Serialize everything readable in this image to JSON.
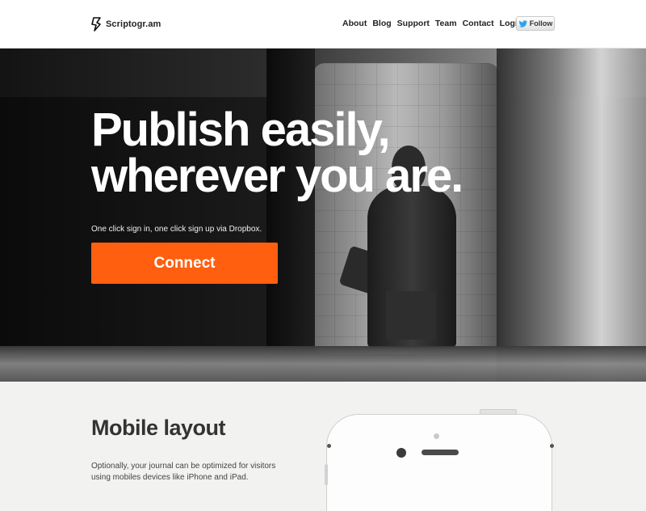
{
  "header": {
    "logo_text": "Scriptogr.am",
    "nav": [
      "About",
      "Blog",
      "Support",
      "Team",
      "Contact",
      "Login"
    ],
    "follow_label": "Follow"
  },
  "hero": {
    "title_line1": "Publish easily,",
    "title_line2": "wherever you are.",
    "subtitle": "One click sign in, one click sign up via Dropbox.",
    "cta_label": "Connect"
  },
  "features": {
    "title": "Mobile layout",
    "text": "Optionally, your journal can be optimized for visitors using mobiles devices like iPhone and iPad."
  },
  "colors": {
    "accent": "#ff5f0f",
    "twitter_blue": "#2aa3ef"
  },
  "icons": {
    "logo": "scriptogram-logo-icon",
    "twitter": "twitter-bird-icon"
  }
}
